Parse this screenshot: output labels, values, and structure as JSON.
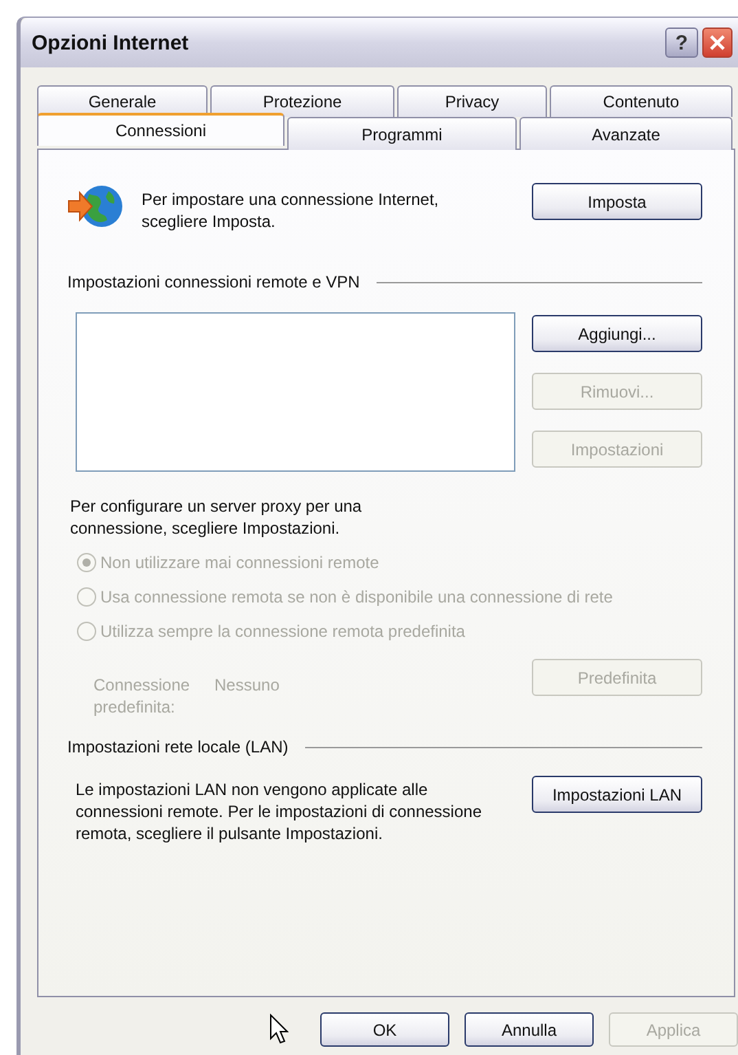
{
  "window": {
    "title": "Opzioni Internet",
    "help": "?"
  },
  "tab_rows": [
    [
      {
        "label": "Generale",
        "selected": false
      },
      {
        "label": "Protezione",
        "selected": false
      },
      {
        "label": "Privacy",
        "selected": false
      },
      {
        "label": "Contenuto",
        "selected": false
      }
    ],
    [
      {
        "label": "Connessioni",
        "selected": true
      },
      {
        "label": "Programmi",
        "selected": false
      },
      {
        "label": "Avanzate",
        "selected": false
      }
    ]
  ],
  "setup": {
    "text": "Per impostare una connessione Internet, scegliere Imposta.",
    "button": {
      "label": "Imposta",
      "disabled": false
    }
  },
  "dialup": {
    "group_label": "Impostazioni connessioni remote e VPN",
    "buttons": [
      {
        "label": "Aggiungi...",
        "disabled": false
      },
      {
        "label": "Rimuovi...",
        "disabled": true
      },
      {
        "label": "Impostazioni",
        "disabled": true
      }
    ],
    "proxy_text": "Per configurare un server proxy per una connessione, scegliere Impostazioni.",
    "options": [
      {
        "label": "Non utilizzare mai connessioni remote",
        "selected": true,
        "disabled": true
      },
      {
        "label": "Usa connessione remota se non è disponibile una connessione di rete",
        "selected": false,
        "disabled": true
      },
      {
        "label": "Utilizza sempre la connessione remota predefinita",
        "selected": false,
        "disabled": true
      }
    ],
    "default_label": "Connessione predefinita:",
    "default_value": "Nessuno",
    "default_disabled": true,
    "default_button": {
      "label": "Predefinita",
      "disabled": true
    }
  },
  "lan": {
    "group_label": "Impostazioni rete locale (LAN)",
    "text": "Le impostazioni LAN non vengono applicate alle connessioni remote. Per le impostazioni di connessione remota, scegliere il pulsante Impostazioni.",
    "button": {
      "label": "Impostazioni LAN",
      "disabled": false
    }
  },
  "footer_buttons": [
    {
      "label": "OK",
      "disabled": false
    },
    {
      "label": "Annulla",
      "disabled": false
    },
    {
      "label": "Applica",
      "disabled": true
    }
  ]
}
